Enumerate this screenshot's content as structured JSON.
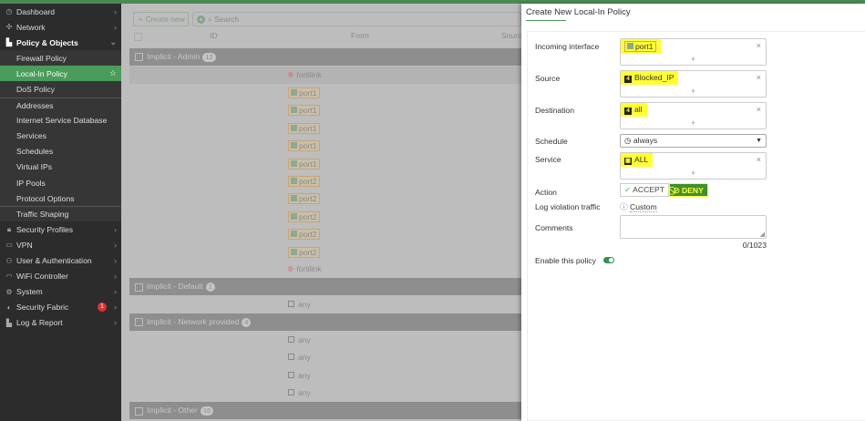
{
  "sidebar": {
    "items": [
      {
        "label": "Dashboard",
        "icon": "dashboard-icon"
      },
      {
        "label": "Network",
        "icon": "network-icon"
      },
      {
        "label": "Policy & Objects",
        "icon": "policy-icon"
      },
      {
        "label": "Firewall Policy"
      },
      {
        "label": "Local-In Policy"
      },
      {
        "label": "DoS Policy"
      },
      {
        "label": "Addresses"
      },
      {
        "label": "Internet Service Database"
      },
      {
        "label": "Services"
      },
      {
        "label": "Schedules"
      },
      {
        "label": "Virtual IPs"
      },
      {
        "label": "IP Pools"
      },
      {
        "label": "Protocol Options"
      },
      {
        "label": "Traffic Shaping"
      },
      {
        "label": "Security Profiles",
        "icon": "lock-icon"
      },
      {
        "label": "VPN",
        "icon": "laptop-icon"
      },
      {
        "label": "User & Authentication",
        "icon": "user-icon"
      },
      {
        "label": "WiFi Controller",
        "icon": "wifi-icon"
      },
      {
        "label": "System",
        "icon": "gear-icon"
      },
      {
        "label": "Security Fabric",
        "icon": "fabric-icon",
        "badge": "1"
      },
      {
        "label": "Log & Report",
        "icon": "chart-icon"
      }
    ]
  },
  "toolbar": {
    "create": "Create new",
    "search_placeholder": "Search"
  },
  "table": {
    "headers": [
      "ID",
      "From",
      "Source"
    ],
    "groups": [
      {
        "name": "Implicit - Admin",
        "count": "12",
        "rows": [
          "fortilink",
          "port1",
          "port1",
          "port1",
          "port1",
          "port1",
          "port2",
          "port2",
          "port2",
          "port2",
          "port2",
          "fortilink"
        ]
      },
      {
        "name": "Implicit - Default",
        "count": "1",
        "rows": [
          "any"
        ]
      },
      {
        "name": "Implicit - Network provided",
        "count": "4",
        "rows": [
          "any",
          "any",
          "any",
          "any"
        ]
      },
      {
        "name": "Implicit - Other",
        "count": "16",
        "rows": []
      }
    ]
  },
  "panel": {
    "title": "Create New Local-In Policy",
    "incoming_label": "Incoming interface",
    "incoming": "port1",
    "source_label": "Source",
    "source": "Blocked_IP",
    "dest_label": "Destination",
    "dest": "all",
    "schedule_label": "Schedule",
    "schedule": "always",
    "service_label": "Service",
    "service": "ALL",
    "action_label": "Action",
    "accept": "ACCEPT",
    "deny": "DENY",
    "log_label": "Log violation traffic",
    "log_value": "Custom",
    "comments_label": "Comments",
    "comments_count": "0/1023",
    "enable_label": "Enable this policy",
    "enabled": true
  }
}
